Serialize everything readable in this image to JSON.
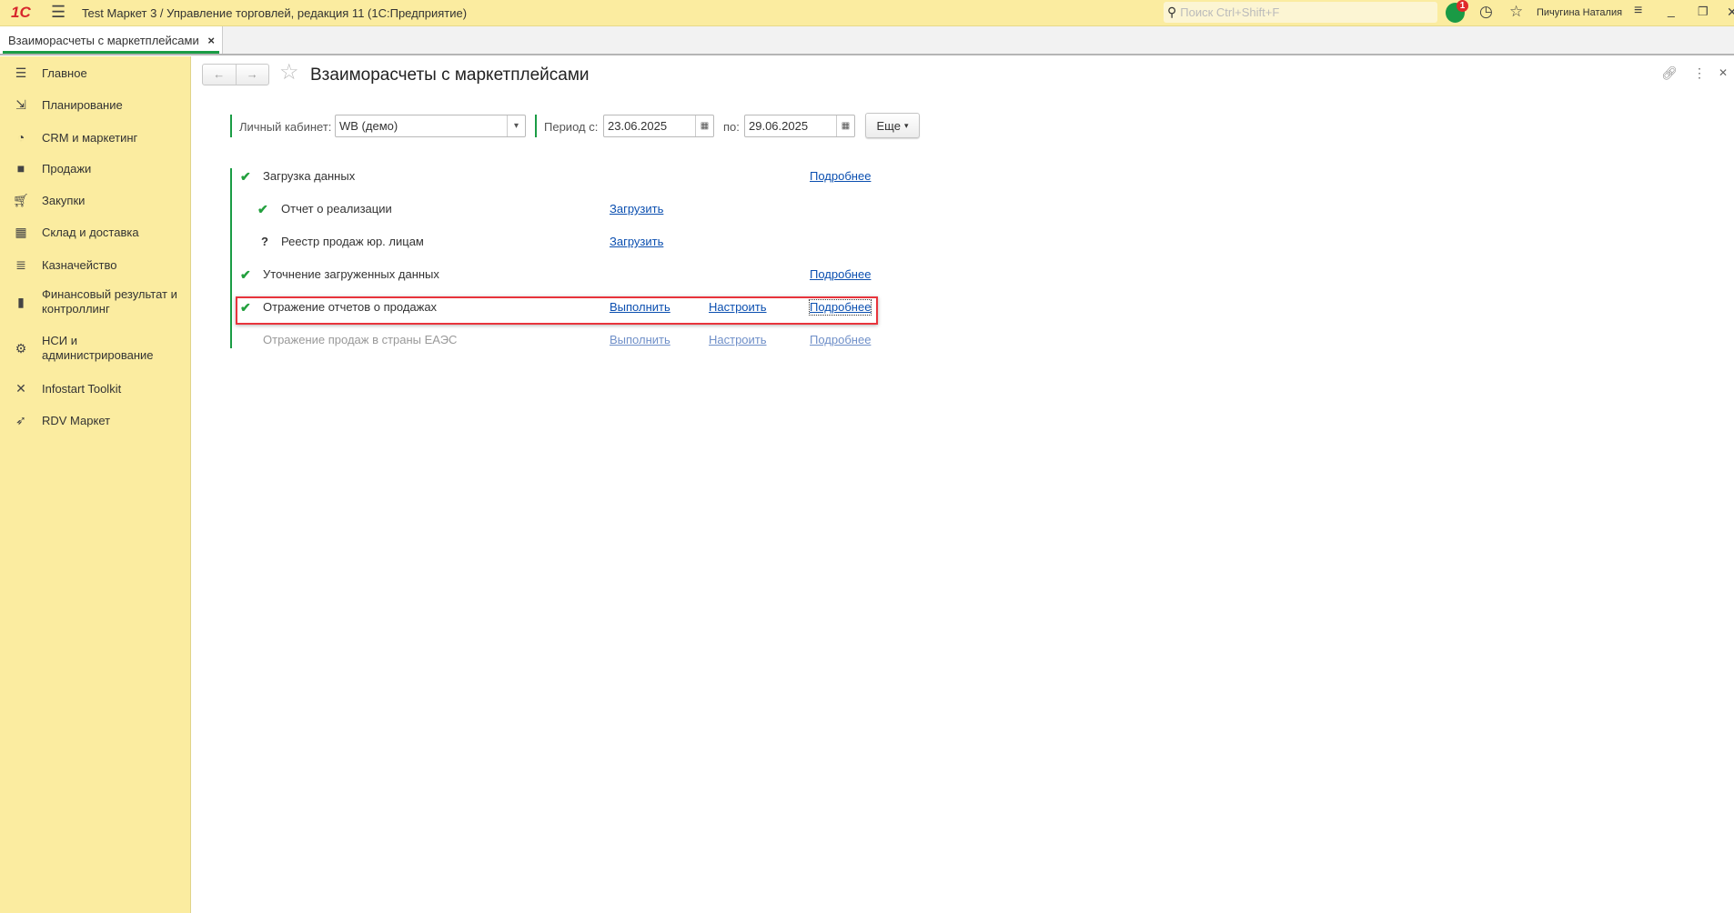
{
  "titlebar": {
    "logo": "1С",
    "title": "Test Маркет 3 / Управление торговлей, редакция 11  (1С:Предприятие)",
    "search_placeholder": "Поиск Ctrl+Shift+F",
    "notification_count": "1",
    "user_name": "Пичугина Наталия",
    "icons": [
      "hamburger-icon",
      "search-icon",
      "notification-icon",
      "history-icon",
      "star-icon",
      "settings-menu-icon",
      "minimize-icon",
      "restore-icon",
      "close-icon"
    ]
  },
  "tabs": [
    {
      "label": "Взаиморасчеты с маркетплейсами",
      "close": "×",
      "active": true
    }
  ],
  "sidebar": {
    "items": [
      {
        "label": "Главное",
        "icon": "menu-icon"
      },
      {
        "label": "Планирование",
        "icon": "planning-icon"
      },
      {
        "label": "CRM и маркетинг",
        "icon": "pie-chart-icon"
      },
      {
        "label": "Продажи",
        "icon": "bag-icon"
      },
      {
        "label": "Закупки",
        "icon": "cart-icon"
      },
      {
        "label": "Склад и доставка",
        "icon": "warehouse-icon"
      },
      {
        "label": "Казначейство",
        "icon": "coins-icon"
      },
      {
        "label": "Финансовый результат и контроллинг",
        "icon": "bar-chart-icon"
      },
      {
        "label": "НСИ и администрирование",
        "icon": "gear-icon"
      },
      {
        "label": "Infostart Toolkit",
        "icon": "tools-icon"
      },
      {
        "label": "RDV Маркет",
        "icon": "rocket-icon"
      }
    ]
  },
  "form": {
    "title": "Взаиморасчеты с маркетплейсами",
    "filters": {
      "account_label": "Личный кабинет:",
      "account_value": "WB (демо)",
      "period_from_label": "Период с:",
      "period_from_value": "23.06.2025",
      "period_to_label": "по:",
      "period_to_value": "29.06.2025",
      "more_label": "Еще"
    },
    "steps": [
      {
        "status": "done",
        "label": "Загрузка данных",
        "details": "Подробнее"
      },
      {
        "status": "done",
        "label": "Отчет о реализации",
        "load": "Загрузить",
        "sub": true
      },
      {
        "status": "unknown",
        "status_mark": "?",
        "label": "Реестр продаж юр. лицам",
        "load": "Загрузить",
        "sub": true
      },
      {
        "status": "done",
        "label": "Уточнение загруженных данных",
        "details": "Подробнее"
      },
      {
        "status": "done",
        "label": "Отражение отчетов о продажах",
        "run": "Выполнить",
        "configure": "Настроить",
        "details": "Подробнее",
        "highlighted": true
      },
      {
        "status": "disabled",
        "label": "Отражение продаж в страны ЕАЭС",
        "run": "Выполнить",
        "configure": "Настроить",
        "details": "Подробнее"
      }
    ]
  },
  "colors": {
    "accent_green": "#1a9c45",
    "highlight_red": "#e8343c",
    "panel_yellow": "#fbeca0",
    "link_blue": "#0b4fb0"
  }
}
